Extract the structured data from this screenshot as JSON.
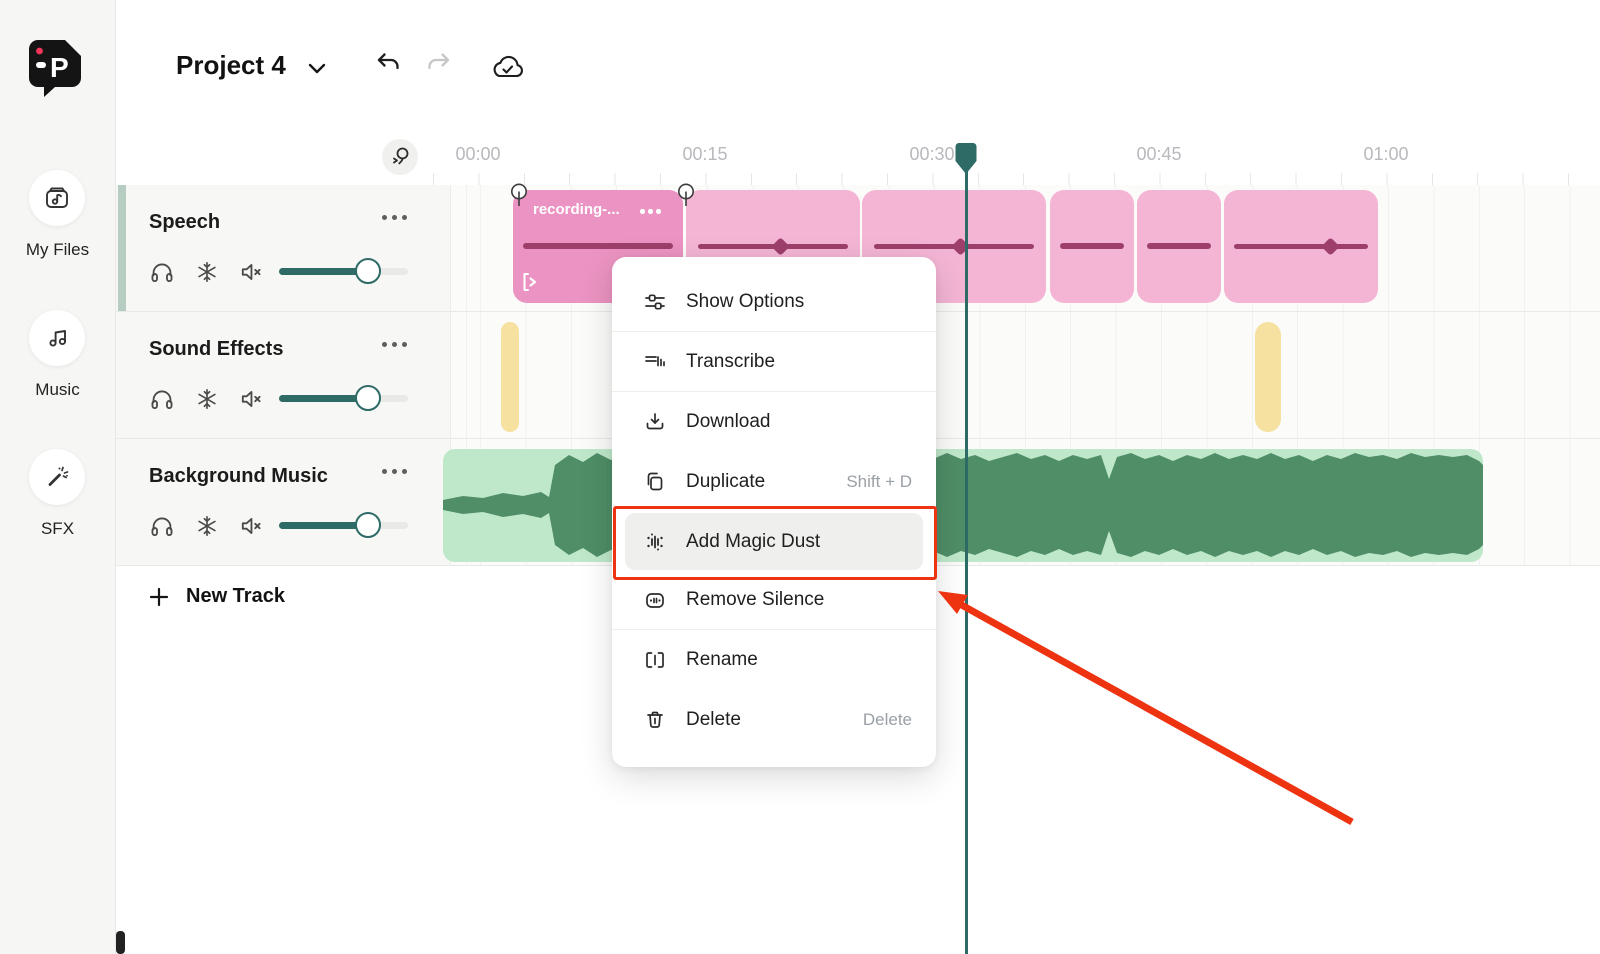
{
  "topbar": {
    "project_title": "Project 4"
  },
  "sidebar": {
    "items": [
      {
        "label": "My Files"
      },
      {
        "label": "Music"
      },
      {
        "label": "SFX"
      }
    ]
  },
  "ruler": {
    "labels": [
      "00:00",
      "00:15",
      "00:30",
      "00:45",
      "01:00"
    ]
  },
  "tracks": [
    {
      "name": "Speech",
      "clip_label": "recording-..."
    },
    {
      "name": "Sound Effects"
    },
    {
      "name": "Background Music"
    }
  ],
  "new_track": {
    "label": "New Track"
  },
  "context_menu": {
    "items": [
      {
        "label": "Show Options",
        "shortcut": ""
      },
      {
        "label": "Transcribe",
        "shortcut": ""
      },
      {
        "label": "Download",
        "shortcut": ""
      },
      {
        "label": "Duplicate",
        "shortcut": "Shift + D"
      },
      {
        "label": "Add Magic Dust",
        "shortcut": ""
      },
      {
        "label": "Remove Silence",
        "shortcut": ""
      },
      {
        "label": "Rename",
        "shortcut": ""
      },
      {
        "label": "Delete",
        "shortcut": "Delete"
      }
    ]
  },
  "colors": {
    "accent_teal": "#2E6B66",
    "speech_clip": "#F4B5D4",
    "speech_clip_selected": "#EB93C2",
    "speech_waveform": "#9D3F6A",
    "music_clip": "#BFE8CA",
    "music_waveform": "#4F8E67",
    "sfx_clip": "#F6E1A0",
    "annotation_red": "#EE3311"
  }
}
